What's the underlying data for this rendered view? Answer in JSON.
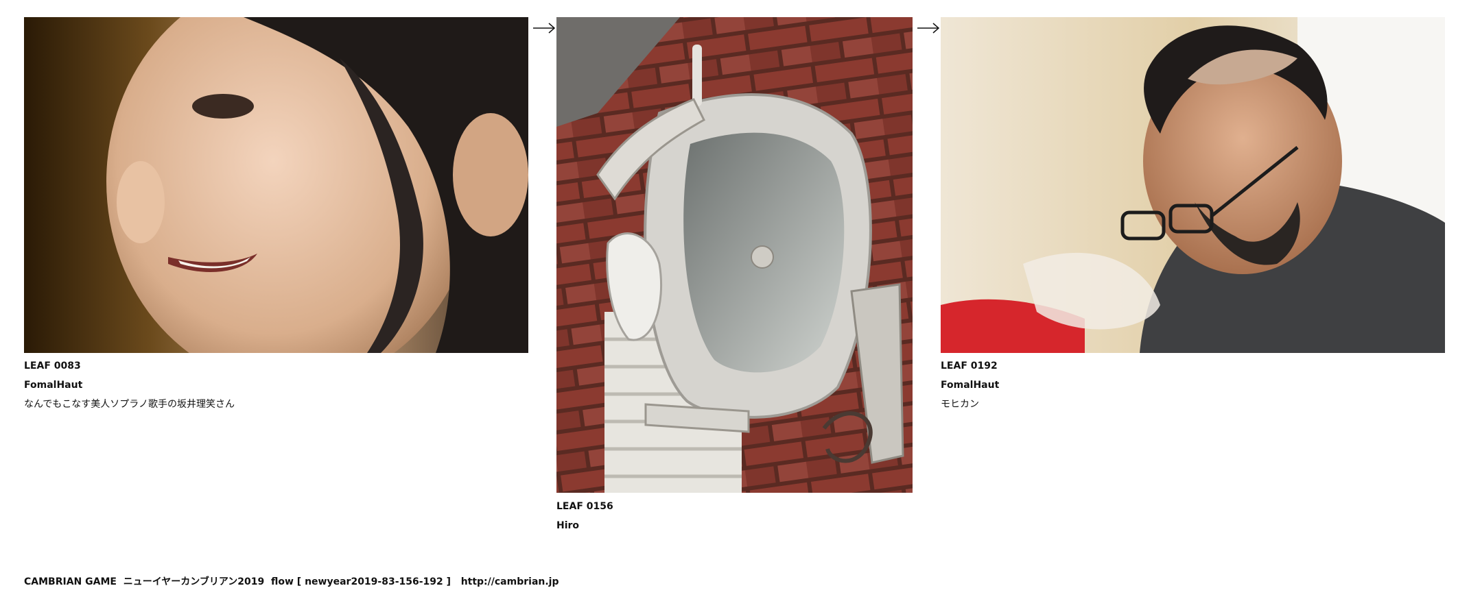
{
  "arrow_glyph": "→",
  "leaves": [
    {
      "id": "LEAF 0083",
      "author": "FomalHaut",
      "description": "なんでもこなす美人ソプラノ歌手の坂井理笑さん",
      "image_subject": "smiling-woman-portrait"
    },
    {
      "id": "LEAF 0156",
      "author": "Hiro",
      "description": "",
      "image_subject": "white-ornate-wall-lantern-on-brick"
    },
    {
      "id": "LEAF 0192",
      "author": "FomalHaut",
      "description": "モヒカン",
      "image_subject": "man-with-mohawk-and-glasses"
    }
  ],
  "footer": {
    "text": "CAMBRIAN GAME  ニューイヤーカンブリアン2019  flow [ newyear2019-83-156-192 ]   ",
    "link": "http://cambrian.jp"
  }
}
